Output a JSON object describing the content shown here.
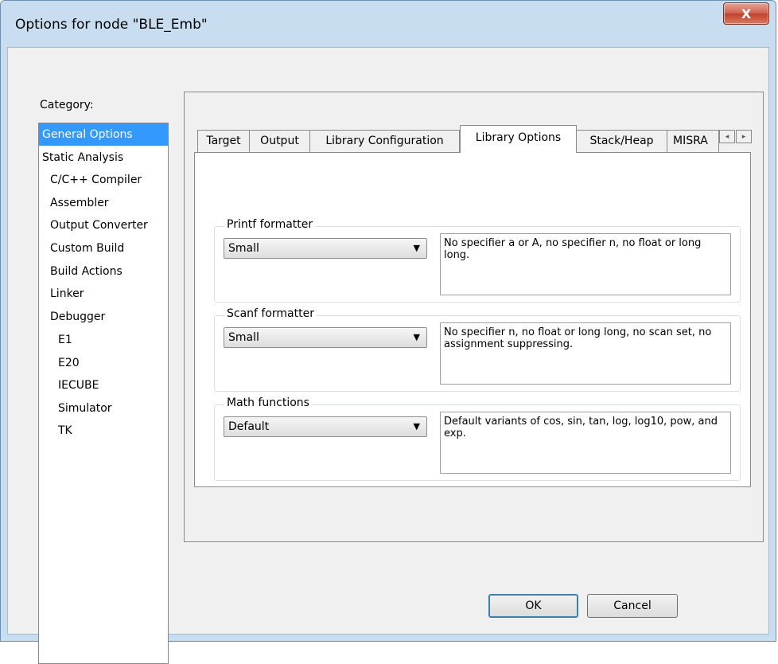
{
  "window": {
    "title": "Options for node \"BLE_Emb\"",
    "close_glyph": "X"
  },
  "category": {
    "label": "Category:",
    "items": [
      {
        "label": "General Options"
      },
      {
        "label": "Static Analysis"
      },
      {
        "label": "C/C++ Compiler"
      },
      {
        "label": "Assembler"
      },
      {
        "label": "Output Converter"
      },
      {
        "label": "Custom Build"
      },
      {
        "label": "Build Actions"
      },
      {
        "label": "Linker"
      },
      {
        "label": "Debugger"
      },
      {
        "label": "E1"
      },
      {
        "label": "E20"
      },
      {
        "label": "IECUBE"
      },
      {
        "label": "Simulator"
      },
      {
        "label": "TK"
      }
    ]
  },
  "tabs": [
    {
      "label": "Target"
    },
    {
      "label": "Output"
    },
    {
      "label": "Library Configuration"
    },
    {
      "label": "Library Options"
    },
    {
      "label": "Stack/Heap"
    },
    {
      "label": "MISRA"
    }
  ],
  "tab_scroll": {
    "left_glyph": "◂",
    "right_glyph": "▸"
  },
  "groups": [
    {
      "title": "Printf formatter",
      "selected": "Small",
      "description": "No specifier a or A, no specifier n, no float or long long."
    },
    {
      "title": "Scanf formatter",
      "selected": "Small",
      "description": "No specifier n, no float or long long, no scan set, no assignment suppressing."
    },
    {
      "title": "Math functions",
      "selected": "Default",
      "description": "Default variants of cos, sin, tan, log, log10, pow, and exp."
    }
  ],
  "buttons": {
    "ok": "OK",
    "cancel": "Cancel"
  },
  "combo_arrow_glyph": "▼"
}
